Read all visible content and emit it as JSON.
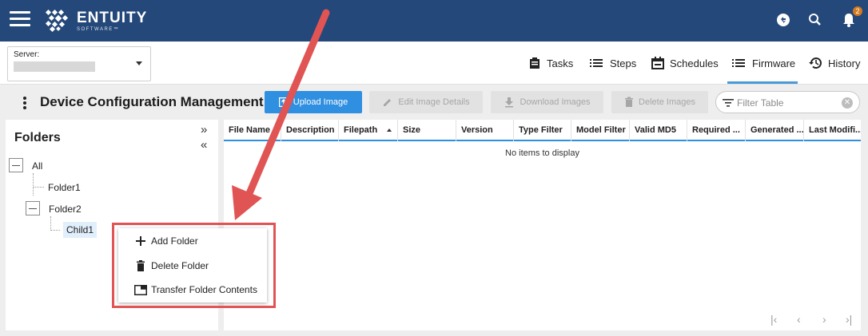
{
  "brand": {
    "name": "ENTUITY",
    "sub": "SOFTWARE™"
  },
  "notifications": {
    "count": "2"
  },
  "server": {
    "label": "Server:"
  },
  "nav": {
    "tasks": "Tasks",
    "steps": "Steps",
    "schedules": "Schedules",
    "firmware": "Firmware",
    "history": "History",
    "active": "Firmware"
  },
  "page": {
    "title": "Device Configuration Management"
  },
  "toolbar": {
    "upload": "Upload Image",
    "edit": "Edit Image Details",
    "download": "Download Images",
    "delete": "Delete Images",
    "filter_placeholder": "Filter Table"
  },
  "folders": {
    "title": "Folders",
    "tree": [
      {
        "label": "All",
        "expanded": true,
        "level": 0
      },
      {
        "label": "Folder1",
        "level": 1
      },
      {
        "label": "Folder2",
        "expanded": true,
        "level": 1
      },
      {
        "label": "Child1",
        "level": 2,
        "selected": true
      }
    ]
  },
  "table": {
    "columns": [
      "File Name",
      "Description",
      "Filepath",
      "Size",
      "Version",
      "Type Filter",
      "Model Filter",
      "Valid MD5",
      "Required ...",
      "Generated ...",
      "Last Modifi..."
    ],
    "sorted_column": "Filepath",
    "sort_direction": "ascending",
    "empty_message": "No items to display"
  },
  "context_menu": {
    "items": [
      "Add Folder",
      "Delete Folder",
      "Transfer Folder Contents"
    ]
  },
  "colors": {
    "header": "#24487a",
    "accent": "#2f8fe0",
    "annotation": "#e05454"
  }
}
